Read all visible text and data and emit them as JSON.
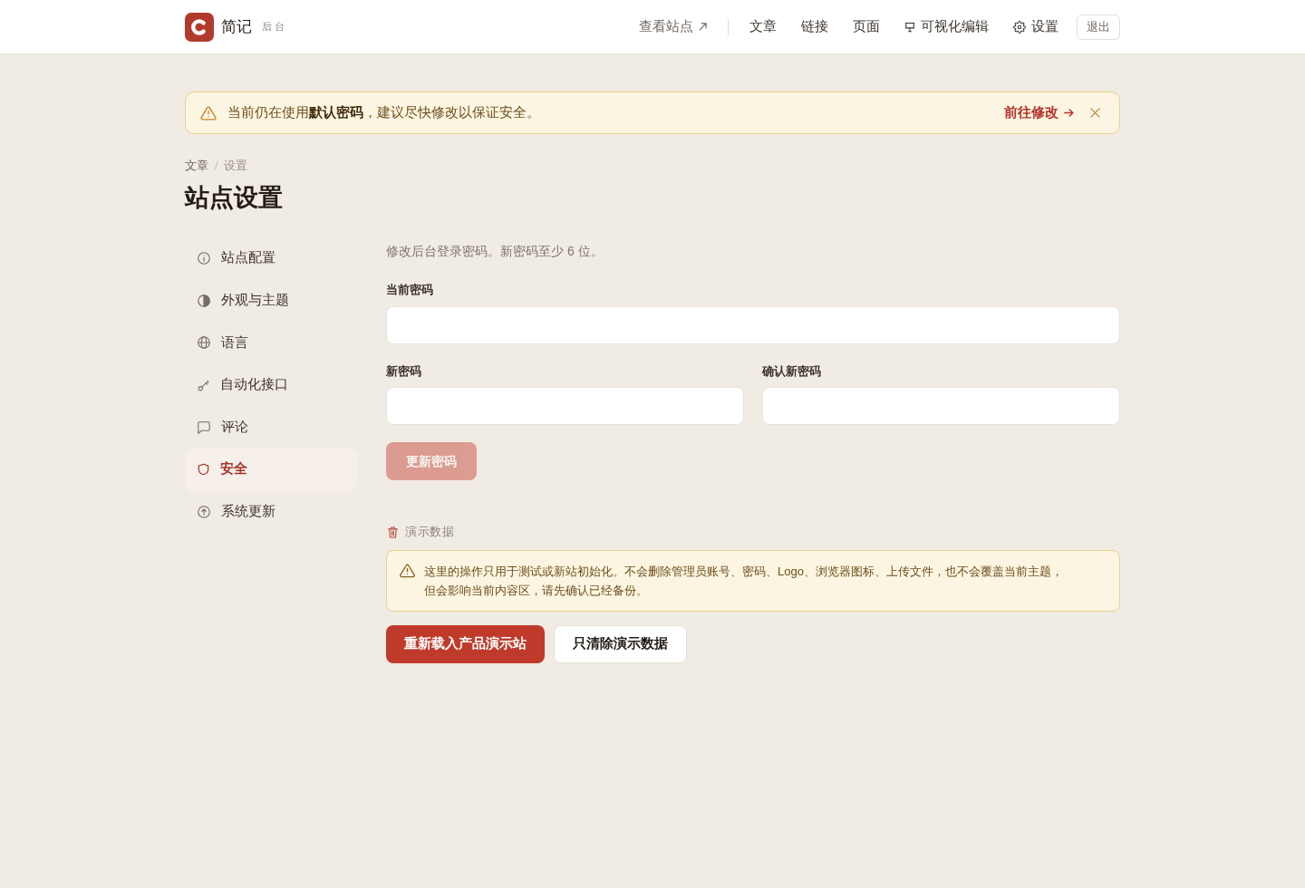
{
  "header": {
    "brand": "简记",
    "brand_subtitle": "后台",
    "nav": [
      {
        "label": "查看站点",
        "kind": "external"
      },
      {
        "label": "文章",
        "kind": "text"
      },
      {
        "label": "链接",
        "kind": "text"
      },
      {
        "label": "页面",
        "kind": "text"
      },
      {
        "label": "可视化编辑",
        "kind": "editor"
      },
      {
        "label": "设置",
        "kind": "settings"
      }
    ],
    "logout": "退出"
  },
  "alert": {
    "text": "当前仍在使用**默认密码**，建议尽快修改以保证安全。",
    "action": "前往修改"
  },
  "breadcrumb": {
    "items": [
      "文章",
      "设置"
    ],
    "separator": "/"
  },
  "title": "站点设置",
  "sidebar": {
    "items": [
      {
        "label": "站点配置",
        "selected": false
      },
      {
        "label": "外观与主题",
        "selected": false
      },
      {
        "label": "语言",
        "selected": false
      },
      {
        "label": "自动化接口",
        "selected": false
      },
      {
        "label": "评论",
        "selected": false
      },
      {
        "label": "安全",
        "selected": true
      },
      {
        "label": "系统更新",
        "selected": false
      }
    ]
  },
  "password_form": {
    "description": "修改后台登录密码。新密码至少 6 位。",
    "rows": [
      [
        {
          "label": "当前密码"
        }
      ],
      [
        {
          "label": "新密码"
        },
        {
          "label": "确认新密码"
        }
      ]
    ],
    "submit": {
      "label": "更新密码",
      "disabled": true
    }
  },
  "demo_data": {
    "title": "演示数据",
    "warning": "这里的操作只用于测试或新站初始化。不会删除管理员账号、密码、Logo、浏览器图标、上传文件，也不会覆盖当前主题，但会影响当前内容区，请先确认已经备份。",
    "buttons": [
      {
        "label": "重新载入产品演示站",
        "kind": "primary"
      },
      {
        "label": "只清除演示数据",
        "kind": "secondary"
      }
    ]
  }
}
